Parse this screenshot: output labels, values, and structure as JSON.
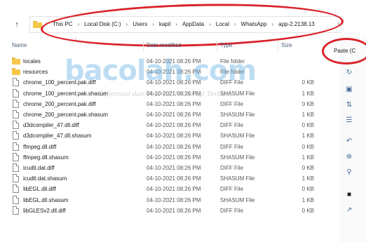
{
  "address_bar": {
    "crumbs": [
      "This PC",
      "Local Disk (C:)",
      "Users",
      "kapil",
      "AppData",
      "Local",
      "WhatsApp",
      "app-2.2138.13"
    ]
  },
  "columns": {
    "name": "Name",
    "date": "Date modified",
    "type": "Type",
    "size": "Size"
  },
  "command_bar": {
    "paste_label": "Paste (C"
  },
  "watermark": {
    "brand": "bacolah.com",
    "tagline": "Informasi dan Tutorial Teknologi Terbaru"
  },
  "files": [
    {
      "name": "locales",
      "date": "04-10-2021 08:26 PM",
      "type": "File folder",
      "size": "",
      "kind": "folder"
    },
    {
      "name": "resources",
      "date": "04-10-2021 08:26 PM",
      "type": "File folder",
      "size": "",
      "kind": "folder"
    },
    {
      "name": "chrome_100_percent.pak.diff",
      "date": "04-10-2021 08:26 PM",
      "type": "DIFF File",
      "size": "0 KB",
      "kind": "file"
    },
    {
      "name": "chrome_100_percent.pak.shasum",
      "date": "04-10-2021 08:26 PM",
      "type": "SHASUM File",
      "size": "1 KB",
      "kind": "file"
    },
    {
      "name": "chrome_200_percent.pak.diff",
      "date": "04-10-2021 08:26 PM",
      "type": "DIFF File",
      "size": "0 KB",
      "kind": "file"
    },
    {
      "name": "chrome_200_percent.pak.shasum",
      "date": "04-10-2021 08:26 PM",
      "type": "SHASUM File",
      "size": "1 KB",
      "kind": "file"
    },
    {
      "name": "d3dcompiler_47.dll.diff",
      "date": "04-10-2021 08:26 PM",
      "type": "DIFF File",
      "size": "0 KB",
      "kind": "file"
    },
    {
      "name": "d3dcompiler_47.dll.shasum",
      "date": "04-10-2021 08:26 PM",
      "type": "SHASUM File",
      "size": "1 KB",
      "kind": "file"
    },
    {
      "name": "ffmpeg.dll.diff",
      "date": "04-10-2021 08:26 PM",
      "type": "DIFF File",
      "size": "0 KB",
      "kind": "file"
    },
    {
      "name": "ffmpeg.dll.shasum",
      "date": "04-10-2021 08:26 PM",
      "type": "SHASUM File",
      "size": "1 KB",
      "kind": "file"
    },
    {
      "name": "icudtl.dat.diff",
      "date": "04-10-2021 08:26 PM",
      "type": "DIFF File",
      "size": "0 KB",
      "kind": "file"
    },
    {
      "name": "icudtl.dat.shasum",
      "date": "04-10-2021 08:26 PM",
      "type": "SHASUM File",
      "size": "1 KB",
      "kind": "file"
    },
    {
      "name": "libEGL.dll.diff",
      "date": "04-10-2021 08:26 PM",
      "type": "DIFF File",
      "size": "0 KB",
      "kind": "file"
    },
    {
      "name": "libEGL.dll.shasum",
      "date": "04-10-2021 08:26 PM",
      "type": "SHASUM File",
      "size": "1 KB",
      "kind": "file"
    },
    {
      "name": "libGLESv2.dll.diff",
      "date": "04-10-2021 08:26 PM",
      "type": "DIFF File",
      "size": "0 KB",
      "kind": "file"
    }
  ],
  "colors": {
    "annotation_red": "#d9222a",
    "folder_yellow": "#f5c84c",
    "header_text": "#4c607a"
  }
}
